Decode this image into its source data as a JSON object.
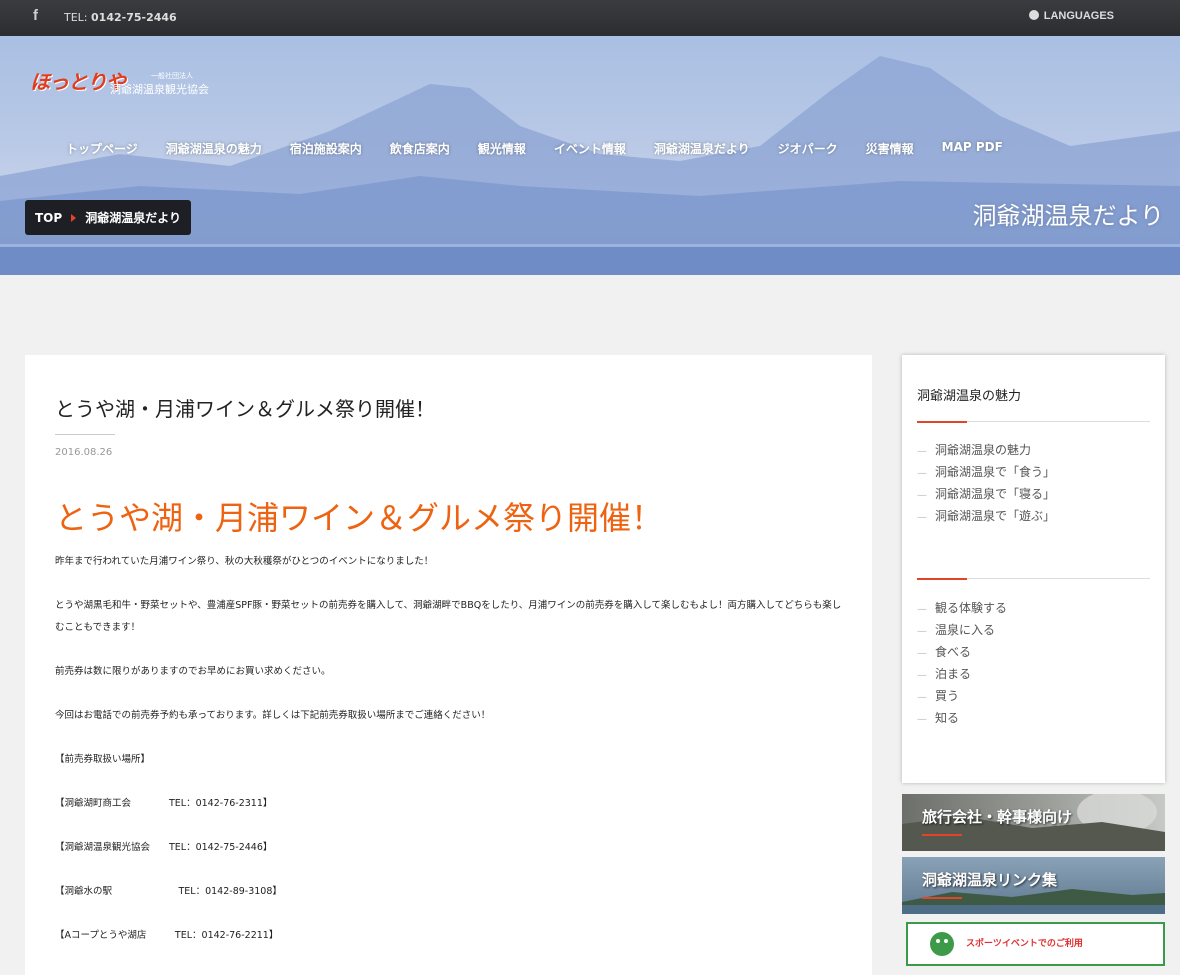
{
  "topbar": {
    "facebook_icon": "facebook-icon",
    "tel_prefix": "TEL: ",
    "tel": "0142-75-2446",
    "languages": "LANGUAGES"
  },
  "logo": {
    "mark": "ほっとりや",
    "sub": "一般社団法人",
    "name": "洞爺湖温泉観光協会"
  },
  "nav": [
    "トップページ",
    "洞爺湖温泉の魅力",
    "宿泊施設案内",
    "飲食店案内",
    "観光情報",
    "イベント情報",
    "洞爺湖温泉だより",
    "ジオパーク",
    "災害情報",
    "MAP PDF"
  ],
  "breadcrumb": {
    "top": "TOP",
    "current": "洞爺湖温泉だより"
  },
  "hero_title": "洞爺湖温泉だより",
  "article": {
    "title": "とうや湖・月浦ワイン＆グルメ祭り開催！",
    "date": "2016.08.26",
    "heading": "とうや湖・月浦ワイン＆グルメ祭り開催！",
    "paragraphs": [
      "昨年まで行われていた月浦ワイン祭り、秋の大秋穫祭がひとつのイベントになりました！",
      "とうや湖黒毛和牛・野菜セットや、豊浦産SPF豚・野菜セットの前売券を購入して、洞爺湖畔でBBQをしたり、月浦ワインの前売券を購入して楽しむもよし！両方購入してどちらも楽しむこともできます！",
      "前売券は数に限りがありますのでお早めにお買い求めください。",
      "今回はお電話での前売券予約も承っております。詳しくは下記前売券取扱い場所までご連絡ください！",
      "【前売券取扱い場所】",
      "【洞爺湖町商工会　　　　TEL：0142-76-2311】",
      "【洞爺湖温泉観光協会　　TEL：0142-75-2446】",
      "【洞爺水の駅　　　　　　　TEL：0142-89-3108】",
      "【Aコープとうや湖店　　　TEL：0142-76-2211】"
    ]
  },
  "sidebar": {
    "title": "洞爺湖温泉の魅力",
    "group1": [
      "洞爺湖温泉の魅力",
      "洞爺湖温泉で「食う」",
      "洞爺湖温泉で「寝る」",
      "洞爺湖温泉で「遊ぶ」"
    ],
    "group2": [
      "観る体験する",
      "温泉に入る",
      "食べる",
      "泊まる",
      "買う",
      "知る"
    ]
  },
  "banners": {
    "travel": "旅行会社・幹事様向け",
    "links": "洞爺湖温泉リンク集",
    "sports": "スポーツイベントでのご利用"
  },
  "colors": {
    "accent": "#ee6311",
    "red": "#e0452a",
    "topbar": "#2f3135"
  }
}
